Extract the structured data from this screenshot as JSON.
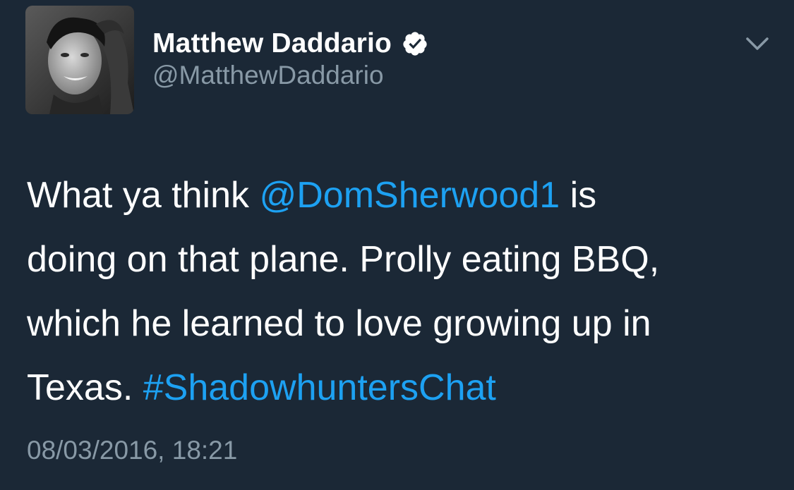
{
  "tweet": {
    "author": {
      "name": "Matthew Daddario",
      "handle": "@MatthewDaddario",
      "verified_icon": "verified-badge-icon",
      "avatar_icon": "profile-photo"
    },
    "menu_icon": "chevron-down-icon",
    "body": {
      "line1_pre": "What ya think ",
      "mention": "@DomSherwood1",
      "line1_post": " is",
      "line2": "doing on that plane. Prolly eating BBQ,",
      "line3": "which he learned to love growing up in",
      "line4_pre": "Texas. ",
      "hashtag": "#ShadowhuntersChat"
    },
    "timestamp": "08/03/2016, 18:21"
  },
  "colors": {
    "background": "#1b2836",
    "text": "#ffffff",
    "secondary": "#8899a6",
    "link": "#1da1f2"
  }
}
